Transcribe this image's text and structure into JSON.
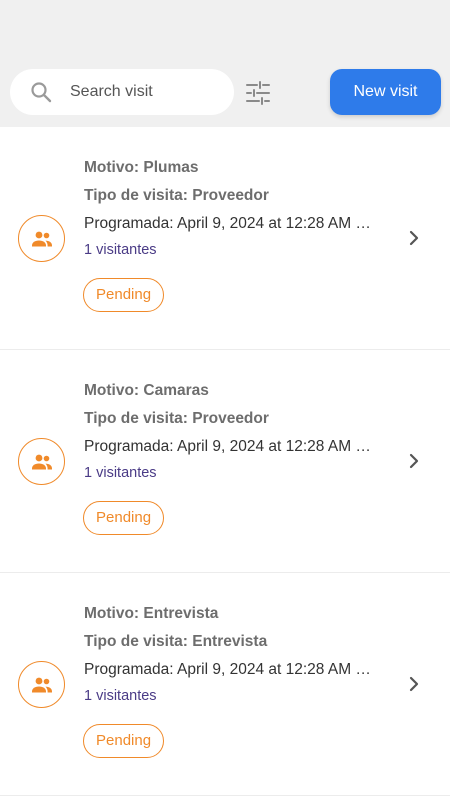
{
  "search": {
    "placeholder": "Search visit"
  },
  "header": {
    "new_visit_label": "New visit"
  },
  "colors": {
    "accent": "#2e7bea",
    "status_pending": "#f08a2a",
    "visitors_text": "#4a3b86"
  },
  "visits": [
    {
      "motivo": "Motivo: Plumas",
      "tipo": "Tipo de visita: Proveedor",
      "programada": "Programada: April 9, 2024 at 12:28 AM C...",
      "visitantes": "1 visitantes",
      "status": "Pending",
      "icon": "people-icon"
    },
    {
      "motivo": "Motivo: Camaras",
      "tipo": "Tipo de visita: Proveedor",
      "programada": "Programada: April 9, 2024 at 12:28 AM C...",
      "visitantes": "1 visitantes",
      "status": "Pending",
      "icon": "people-icon"
    },
    {
      "motivo": "Motivo: Entrevista",
      "tipo": "Tipo de visita: Entrevista",
      "programada": "Programada: April 9, 2024 at 12:28 AM C...",
      "visitantes": "1 visitantes",
      "status": "Pending",
      "icon": "people-icon"
    }
  ]
}
